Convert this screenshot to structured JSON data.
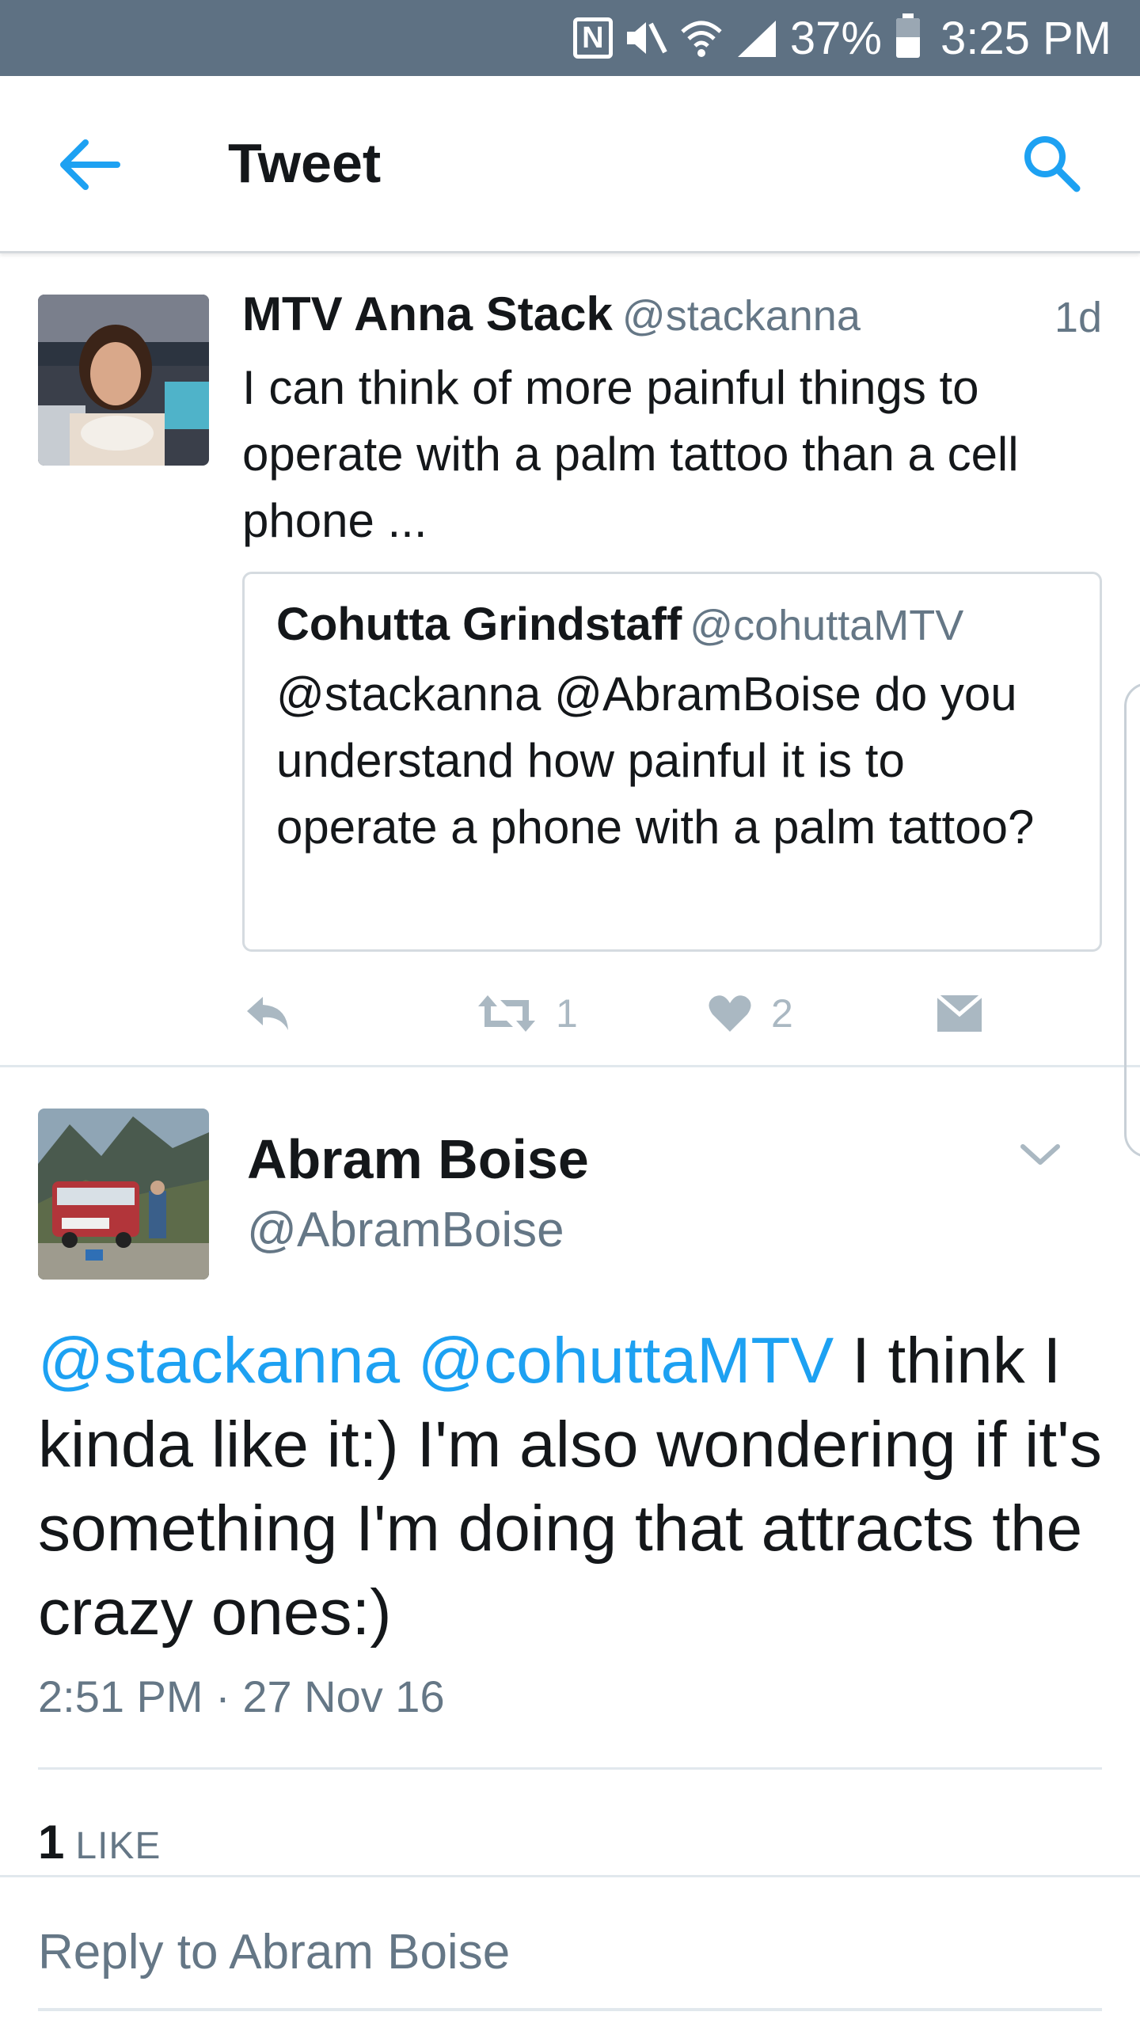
{
  "status_bar": {
    "nfc_letter": "N",
    "battery": "37%",
    "time": "3:25 PM"
  },
  "header": {
    "title": "Tweet"
  },
  "quoted_tweet": {
    "name": "MTV Anna Stack",
    "handle": "@stackanna",
    "time": "1d",
    "text": "I can think of more painful things to operate with a palm tattoo than a cell phone ...",
    "quote": {
      "name": "Cohutta Grindstaff",
      "handle": "@cohuttaMTV",
      "text": "@stackanna @AbramBoise do you understand how painful it is to operate a phone with a palm tattoo?"
    },
    "retweet_count": "1",
    "like_count": "2"
  },
  "main_tweet": {
    "name": "Abram Boise",
    "handle": "@AbramBoise",
    "mention_1": "@stackanna",
    "mention_2": "@cohuttaMTV",
    "text": " I think I kinda like it:) I'm also wondering if it's something I'm doing that attracts the crazy ones:)",
    "timestamp": "2:51 PM · 27 Nov 16",
    "likes_count": "1",
    "likes_label": "LIKE"
  },
  "reply": {
    "placeholder": "Reply to Abram Boise"
  },
  "colors": {
    "status_bar": "#5e7183",
    "accent": "#1da1f2",
    "secondary_text": "#657786",
    "action_icon": "#aab8c2"
  }
}
